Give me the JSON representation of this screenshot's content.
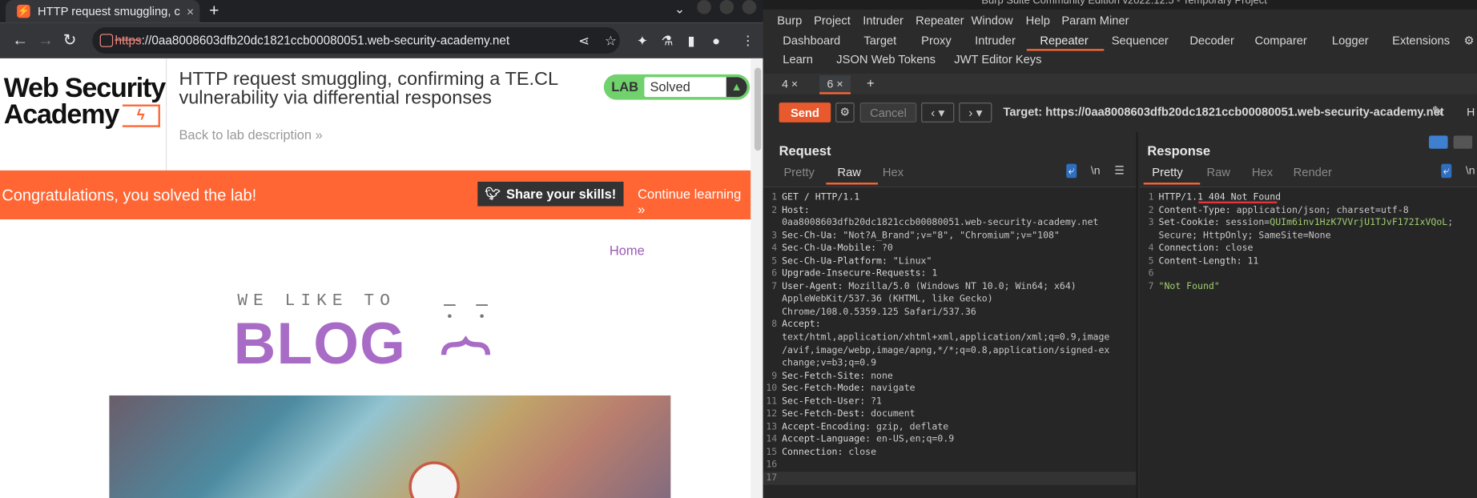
{
  "browser": {
    "tab_title": "HTTP request smuggling, c",
    "tab_close": "×",
    "new_tab": "+",
    "tab_dropdown": "⌄",
    "url_scheme": "https",
    "url_rest": "://0aa8008603dfb20dc1821ccb00080051.web-security-academy.net"
  },
  "page": {
    "logo_line1": "Web Security",
    "logo_line2": "Academy",
    "lab_title": "HTTP request smuggling, confirming a TE.CL vulnerability via differential responses",
    "back_link": "Back to lab description",
    "lab_label": "LAB",
    "lab_status": "Solved",
    "banner_text": "Congratulations, you solved the lab!",
    "share_button": "Share your skills!",
    "continue_link": "Continue learning",
    "home_link": "Home",
    "blog_tag": "WE LIKE TO",
    "blog_big": "BLOG"
  },
  "burp": {
    "title": "Burp Suite Community Edition v2022.12.5 - Temporary Project",
    "menu": [
      "Burp",
      "Project",
      "Intruder",
      "Repeater",
      "Window",
      "Help",
      "Param Miner"
    ],
    "tabs_row1": [
      "Dashboard",
      "Target",
      "Proxy",
      "Intruder",
      "Repeater",
      "Sequencer",
      "Decoder",
      "Comparer",
      "Logger",
      "Extensions"
    ],
    "tabs_row2": [
      "Learn",
      "JSON Web Tokens",
      "JWT Editor Keys"
    ],
    "repeater_tabs": [
      "4 ×",
      "6 ×",
      "+"
    ],
    "send": "Send",
    "cancel": "Cancel",
    "target": "Target: https://0aa8008603dfb20dc1821ccb00080051.web-security-academy.net",
    "http_cut": "H",
    "request_title": "Request",
    "response_title": "Response",
    "req_subtabs": [
      "Pretty",
      "Raw",
      "Hex"
    ],
    "resp_subtabs": [
      "Pretty",
      "Raw",
      "Hex",
      "Render"
    ],
    "newline_label": "\\n",
    "request_lines": [
      {
        "n": "1",
        "k": "GET / HTTP/1.1",
        "v": ""
      },
      {
        "n": "2",
        "k": "Host:",
        "v": ""
      },
      {
        "n": "",
        "k": "",
        "v": "0aa8008603dfb20dc1821ccb00080051.web-security-academy.net"
      },
      {
        "n": "3",
        "k": "Sec-Ch-Ua:",
        "v": " \"Not?A_Brand\";v=\"8\", \"Chromium\";v=\"108\""
      },
      {
        "n": "4",
        "k": "Sec-Ch-Ua-Mobile:",
        "v": " ?0"
      },
      {
        "n": "5",
        "k": "Sec-Ch-Ua-Platform:",
        "v": " \"Linux\""
      },
      {
        "n": "6",
        "k": "Upgrade-Insecure-Requests:",
        "v": " 1"
      },
      {
        "n": "7",
        "k": "User-Agent:",
        "v": " Mozilla/5.0 (Windows NT 10.0; Win64; x64)"
      },
      {
        "n": "",
        "k": "",
        "v": "AppleWebKit/537.36 (KHTML, like Gecko)"
      },
      {
        "n": "",
        "k": "",
        "v": "Chrome/108.0.5359.125 Safari/537.36"
      },
      {
        "n": "8",
        "k": "Accept:",
        "v": ""
      },
      {
        "n": "",
        "k": "",
        "v": "text/html,application/xhtml+xml,application/xml;q=0.9,image"
      },
      {
        "n": "",
        "k": "",
        "v": "/avif,image/webp,image/apng,*/*;q=0.8,application/signed-ex"
      },
      {
        "n": "",
        "k": "",
        "v": "change;v=b3;q=0.9"
      },
      {
        "n": "9",
        "k": "Sec-Fetch-Site:",
        "v": " none"
      },
      {
        "n": "10",
        "k": "Sec-Fetch-Mode:",
        "v": " navigate"
      },
      {
        "n": "11",
        "k": "Sec-Fetch-User:",
        "v": " ?1"
      },
      {
        "n": "12",
        "k": "Sec-Fetch-Dest:",
        "v": " document"
      },
      {
        "n": "13",
        "k": "Accept-Encoding:",
        "v": " gzip, deflate"
      },
      {
        "n": "14",
        "k": "Accept-Language:",
        "v": " en-US,en;q=0.9"
      },
      {
        "n": "15",
        "k": "Connection:",
        "v": " close"
      },
      {
        "n": "16",
        "k": "",
        "v": ""
      },
      {
        "n": "17",
        "k": "",
        "v": ""
      }
    ],
    "response_lines": [
      {
        "n": "1",
        "k": "HTTP/1.1 404 Not Found",
        "v": "",
        "g": false
      },
      {
        "n": "2",
        "k": "Content-Type:",
        "v": " application/json; charset=utf-8",
        "g": false
      },
      {
        "n": "3",
        "k": "Set-Cookie:",
        "v": " session=",
        "g2": "QUIm6inv1HzK7VVrjU1TJvF172IxVQoL",
        "tail": ";",
        "g": false
      },
      {
        "n": "",
        "k": "",
        "v": "Secure; HttpOnly; SameSite=None",
        "g": false
      },
      {
        "n": "4",
        "k": "Connection:",
        "v": " close",
        "g": false
      },
      {
        "n": "5",
        "k": "Content-Length:",
        "v": " 11",
        "g": false
      },
      {
        "n": "6",
        "k": "",
        "v": "",
        "g": false
      },
      {
        "n": "7",
        "k": "",
        "v": "\"Not Found\"",
        "g": true
      }
    ]
  }
}
